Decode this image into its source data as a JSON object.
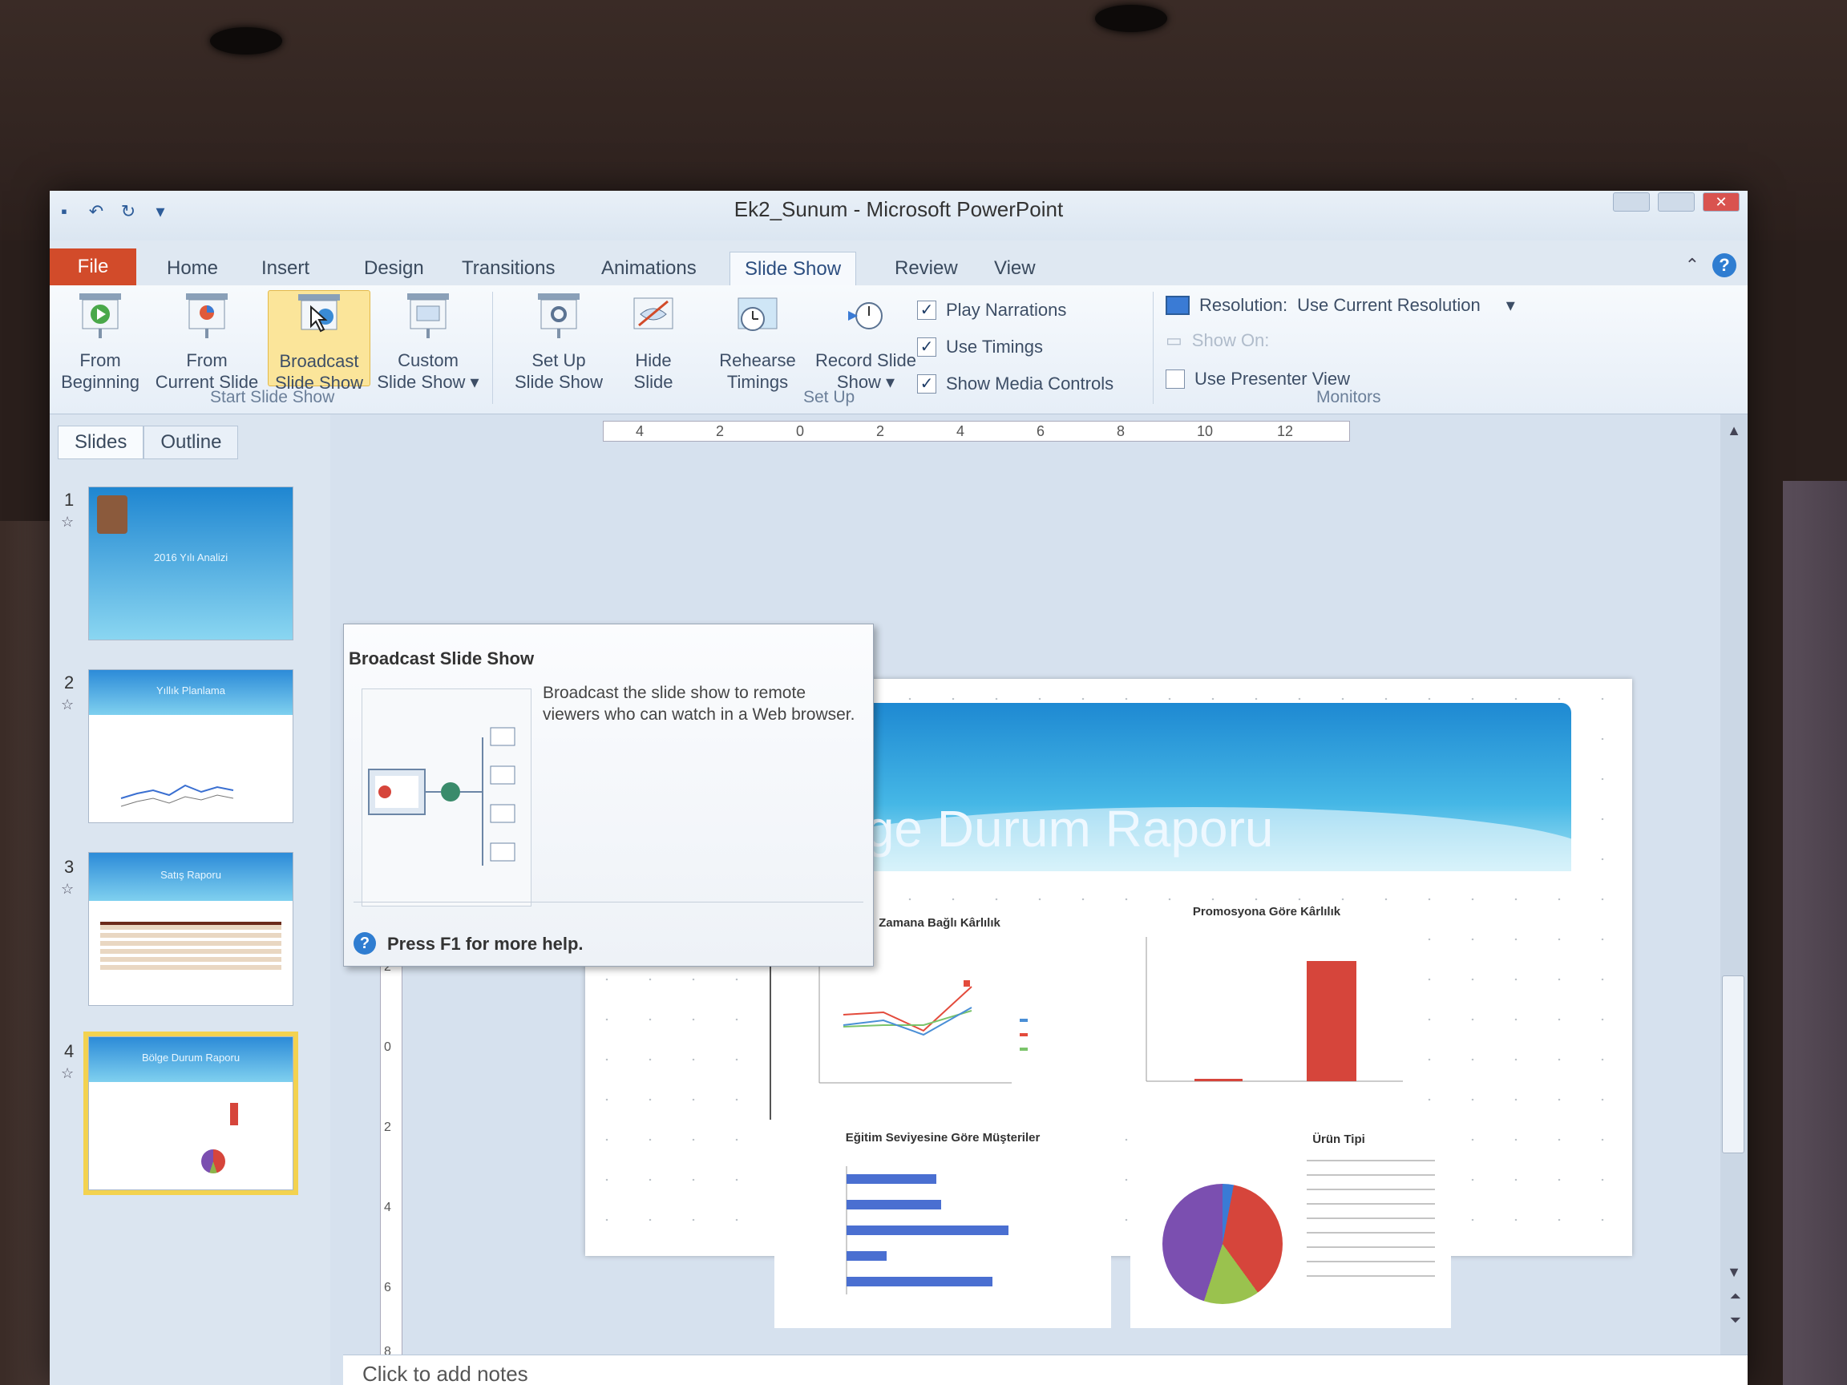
{
  "window": {
    "title": "Ek2_Sunum - Microsoft PowerPoint"
  },
  "tabs": {
    "file": "File",
    "items": [
      "Home",
      "Insert",
      "Design",
      "Transitions",
      "Animations",
      "Slide Show",
      "Review",
      "View"
    ]
  },
  "ribbon": {
    "start_group": "Start Slide Show",
    "from_beginning": [
      "From",
      "Beginning"
    ],
    "from_current": [
      "From",
      "Current Slide"
    ],
    "broadcast": [
      "Broadcast",
      "Slide Show"
    ],
    "custom": [
      "Custom",
      "Slide Show ▾"
    ],
    "setup_group": "Set Up",
    "set_up": [
      "Set Up",
      "Slide Show"
    ],
    "hide_slide": [
      "Hide",
      "Slide"
    ],
    "rehearse": [
      "Rehearse",
      "Timings"
    ],
    "record": [
      "Record Slide",
      "Show ▾"
    ],
    "play_narrations": "Play Narrations",
    "use_timings": "Use Timings",
    "show_media": "Show Media Controls",
    "monitors_group": "Monitors",
    "resolution_label": "Resolution:",
    "resolution_value": "Use Current Resolution",
    "show_on": "Show On:",
    "presenter_view": "Use Presenter View"
  },
  "panel": {
    "tab_slides": "Slides",
    "tab_outline": "Outline"
  },
  "thumbnails": [
    {
      "num": "1",
      "title": "2016 Yılı Analizi"
    },
    {
      "num": "2",
      "title": "Yıllık Planlama"
    },
    {
      "num": "3",
      "title": "Satış Raporu"
    },
    {
      "num": "4",
      "title": "Bölge Durum Raporu"
    }
  ],
  "tooltip": {
    "title": "Broadcast Slide Show",
    "description": "Broadcast the slide show to remote viewers who can watch in a Web browser.",
    "help": "Press F1 for more help."
  },
  "ruler": {
    "h_labels": [
      "4",
      "2",
      "0",
      "2",
      "4",
      "6",
      "8",
      "10",
      "12"
    ],
    "v_labels": [
      "2",
      "0",
      "2",
      "4",
      "6",
      "8"
    ]
  },
  "slide": {
    "title": "ölge Durum Raporu",
    "chart1_title": "Zamana Bağlı Kârlılık",
    "chart2_title": "Promosyona Göre Kârlılık",
    "chart3_title": "Eğitim Seviyesine Göre Müşteriler",
    "chart4_title": "Ürün Tipi"
  },
  "notes": {
    "placeholder": "Click to add notes"
  },
  "colors": {
    "file_tab": "#d24b2a",
    "accent_blue": "#2f7dd1",
    "highlight": "#fbe59a",
    "bar_red": "#d6453b",
    "bar_blue": "#4a6fd1"
  }
}
